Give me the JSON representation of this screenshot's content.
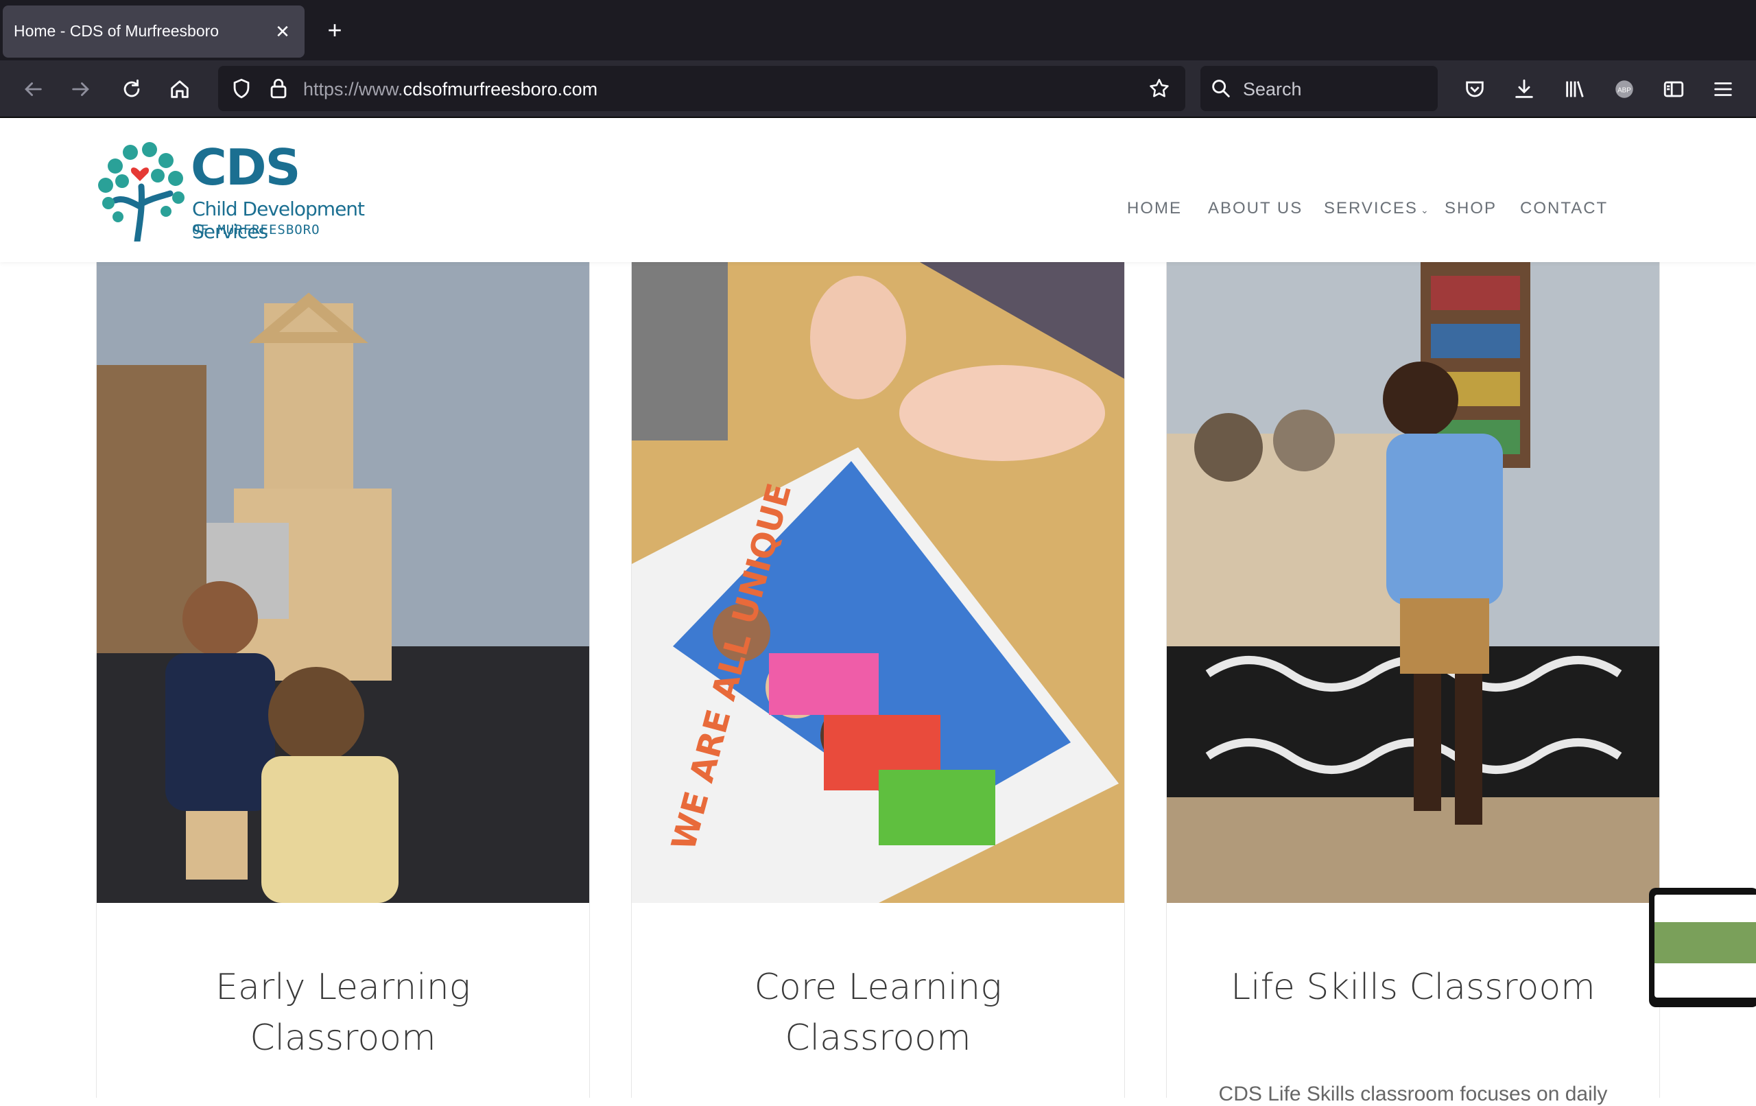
{
  "browser": {
    "tab_title": "Home - CDS of Murfreesboro",
    "url_dim": "https://www.",
    "url_main": "cdsofmurfreesboro.com",
    "search_placeholder": "Search",
    "icons": [
      "back-icon",
      "forward-icon",
      "reload-icon",
      "home-icon",
      "shield-icon",
      "lock-icon",
      "star-icon",
      "search-icon",
      "pocket-icon",
      "download-icon",
      "library-icon",
      "adblock-icon",
      "sidebar-icon",
      "menu-icon"
    ]
  },
  "site": {
    "logo": {
      "cds": "CDS",
      "line1": "Child Development Services",
      "line2": "OF MURFREESBORO"
    },
    "nav": [
      {
        "label": "HOME"
      },
      {
        "label": "ABOUT US"
      },
      {
        "label": "SERVICES"
      },
      {
        "label": "SHOP"
      },
      {
        "label": "CONTACT"
      }
    ]
  },
  "cards": [
    {
      "title_line1": "Early Learning",
      "title_line2": "Classroom"
    },
    {
      "title_line1": "Core Learning",
      "title_line2": "Classroom"
    },
    {
      "title_line1": "Life Skills Classroom",
      "title_line2": "",
      "text": "CDS Life Skills classroom focuses on daily"
    }
  ],
  "colors": {
    "brand": "#1b6f91",
    "heart": "#e53935",
    "tree": "#2aa198"
  }
}
